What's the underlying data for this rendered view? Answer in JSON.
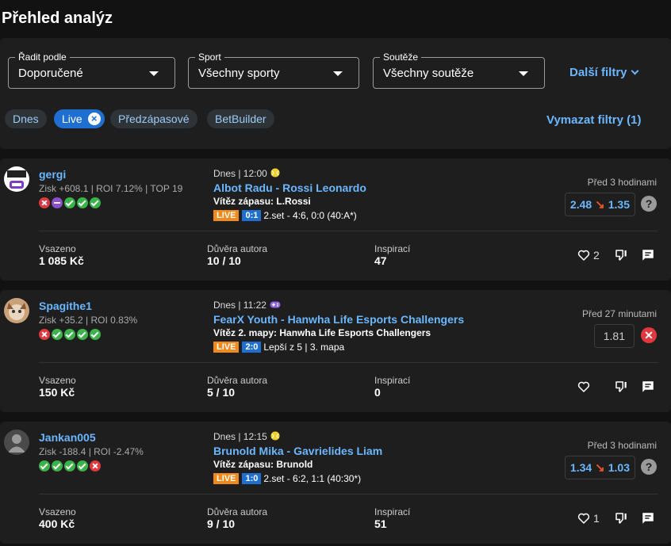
{
  "page_title": "Přehled analýz",
  "filters": {
    "sort": {
      "label": "Řadit podle",
      "value": "Doporučené"
    },
    "sport": {
      "label": "Sport",
      "value": "Všechny sporty"
    },
    "competition": {
      "label": "Soutěže",
      "value": "Všechny soutěže"
    },
    "more_filters": "Další filtry",
    "chips": [
      "Dnes",
      "Live",
      "Předzápasové",
      "BetBuilder"
    ],
    "active_chip": "Live",
    "clear_filters": "Vymazat filtry (1)"
  },
  "cards": [
    {
      "username": "gergi",
      "stats": "Zisk +608.1  |  ROI 7.12%  |  TOP 19",
      "form": [
        "L",
        "V",
        "W",
        "W",
        "W"
      ],
      "when": "Dnes | 12:00",
      "sport_icon": "tennis-ball-icon",
      "match": "Albot Radu - Rossi Leonardo",
      "market_label": "Vítěz zápasu:",
      "market_pick": "L.Rossi",
      "live": "LIVE",
      "score": "0:1",
      "live_info": "2.set - 4:6, 0:0 (40:A*)",
      "time_ago": "Před 3 hodinami",
      "odds_old": "2.48",
      "odds_new": "1.35",
      "status": "unknown",
      "stake_label": "Vsazeno",
      "stake": "1 085 Kč",
      "confidence_label": "Důvěra autora",
      "confidence": "10 / 10",
      "inspired_label": "Inspirací",
      "inspired": "47",
      "likes": "2"
    },
    {
      "username": "Spagithe1",
      "stats": "Zisk +35.2  |  ROI 0.83%",
      "form": [
        "L",
        "W",
        "W",
        "W",
        "W"
      ],
      "when": "Dnes | 11:22",
      "sport_icon": "gamepad-icon",
      "match": "FearX Youth - Hanwha Life Esports Challengers",
      "market_label": "Vítěz 2. mapy:",
      "market_pick": "Hanwha Life Esports Challengers",
      "live": "LIVE",
      "score": "2:0",
      "live_info": "Lepší z 5 | 3. mapa",
      "time_ago": "Před 27 minutami",
      "odds_old": "",
      "odds_new": "1.81",
      "status": "lost",
      "stake_label": "Vsazeno",
      "stake": "150 Kč",
      "confidence_label": "Důvěra autora",
      "confidence": "5 / 10",
      "inspired_label": "Inspirací",
      "inspired": "0",
      "likes": ""
    },
    {
      "username": "Jankan005",
      "stats": "Zisk -188.4  |  ROI -2.47%",
      "form": [
        "W",
        "W",
        "W",
        "W",
        "L"
      ],
      "when": "Dnes | 12:15",
      "sport_icon": "tennis-ball-icon",
      "match": "Brunold Mika - Gavrielides Liam",
      "market_label": "Vítěz zápasu:",
      "market_pick": "Brunold",
      "live": "LIVE",
      "score": "1:0",
      "live_info": "2.set - 6:2, 1:1 (40:30*)",
      "time_ago": "Před 3 hodinami",
      "odds_old": "1.34",
      "odds_new": "1.03",
      "status": "unknown",
      "stake_label": "Vsazeno",
      "stake": "400 Kč",
      "confidence_label": "Důvěra autora",
      "confidence": "9 / 10",
      "inspired_label": "Inspirací",
      "inspired": "51",
      "likes": "1"
    }
  ]
}
